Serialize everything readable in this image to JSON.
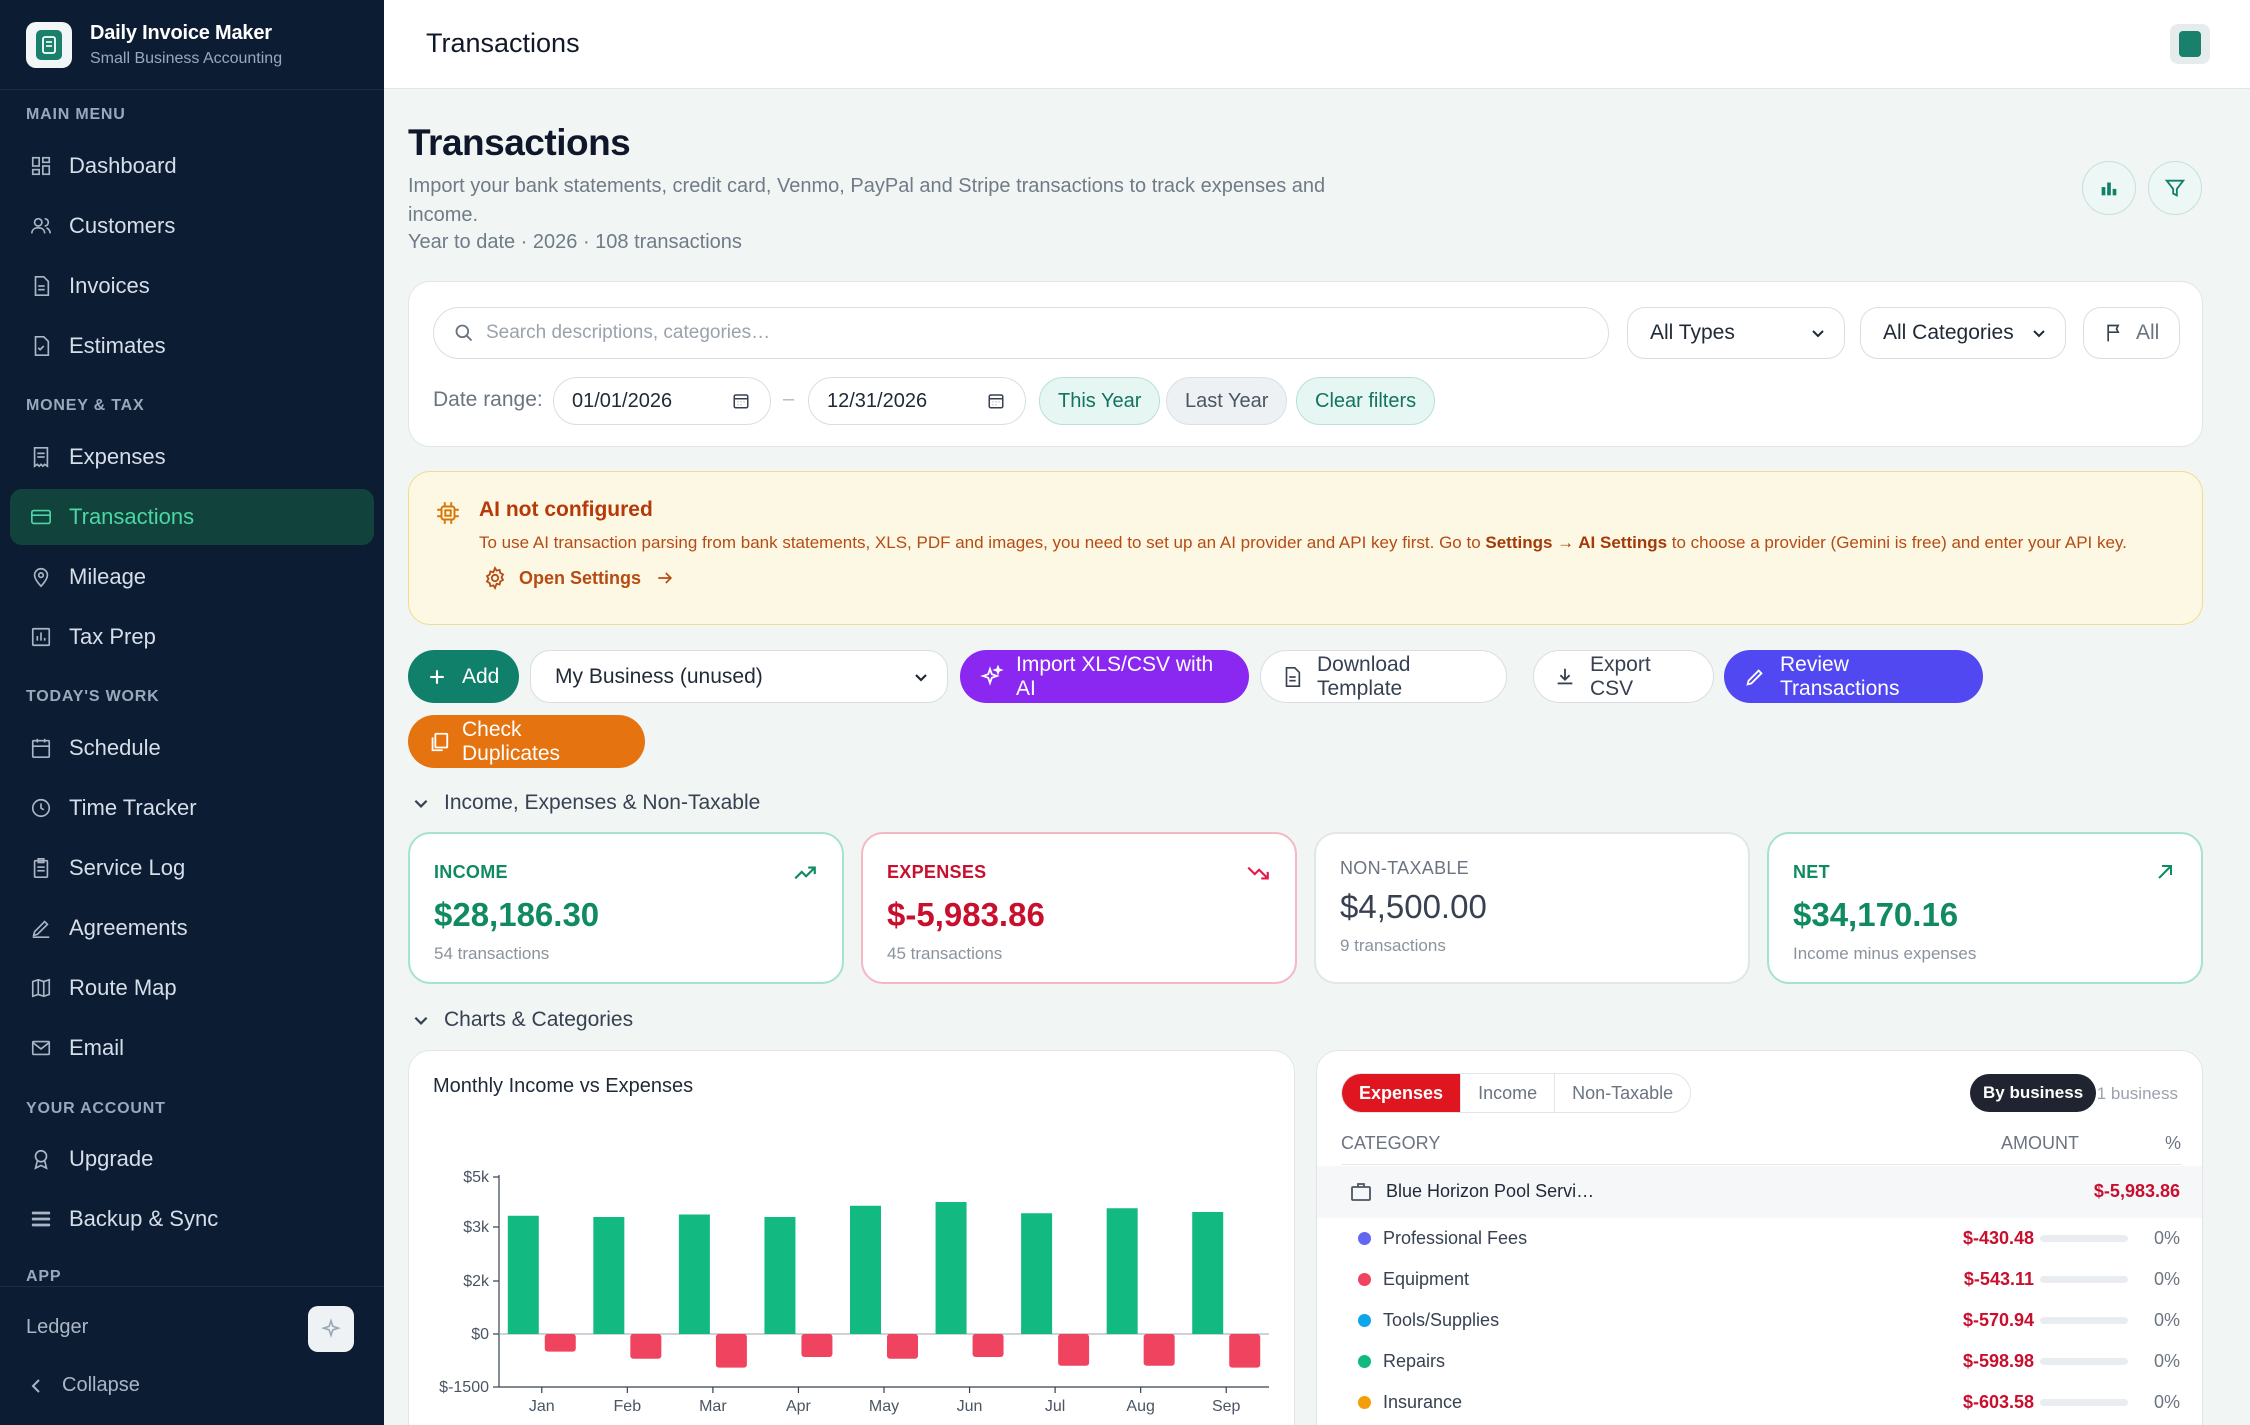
{
  "app": {
    "name": "Daily Invoice Maker",
    "tagline": "Small Business Accounting"
  },
  "sidebar": {
    "sections": [
      {
        "label": "MAIN MENU",
        "items": [
          {
            "label": "Dashboard",
            "icon": "grid-icon"
          },
          {
            "label": "Customers",
            "icon": "users-icon"
          },
          {
            "label": "Invoices",
            "icon": "document-icon"
          },
          {
            "label": "Estimates",
            "icon": "document-check-icon"
          }
        ]
      },
      {
        "label": "MONEY & TAX",
        "items": [
          {
            "label": "Expenses",
            "icon": "receipt-icon"
          },
          {
            "label": "Transactions",
            "icon": "card-icon",
            "active": true
          },
          {
            "label": "Mileage",
            "icon": "pin-icon"
          },
          {
            "label": "Tax Prep",
            "icon": "chart-box-icon"
          }
        ]
      },
      {
        "label": "TODAY'S WORK",
        "items": [
          {
            "label": "Schedule",
            "icon": "calendar-icon"
          },
          {
            "label": "Time Tracker",
            "icon": "clock-icon"
          },
          {
            "label": "Service Log",
            "icon": "clipboard-icon"
          },
          {
            "label": "Agreements",
            "icon": "pen-icon"
          },
          {
            "label": "Route Map",
            "icon": "map-icon"
          },
          {
            "label": "Email",
            "icon": "mail-icon"
          }
        ]
      },
      {
        "label": "YOUR ACCOUNT",
        "items": [
          {
            "label": "Upgrade",
            "icon": "award-icon"
          },
          {
            "label": "Backup & Sync",
            "icon": "layers-icon"
          }
        ]
      },
      {
        "label": "APP",
        "items": []
      }
    ],
    "footer": {
      "ledger_label": "Ledger",
      "collapse_label": "Collapse"
    }
  },
  "header": {
    "title": "Transactions"
  },
  "page": {
    "title": "Transactions",
    "description": "Import your bank statements, credit card, Venmo, PayPal and Stripe transactions to track expenses and income.",
    "meta": "Year to date · 2026 · 108 transactions"
  },
  "filters": {
    "search_placeholder": "Search descriptions, categories…",
    "type_value": "All Types",
    "category_value": "All Categories",
    "flag_value": "All",
    "date_range_label": "Date range:",
    "date_from": "01/01/2026",
    "date_separator": "–",
    "date_to": "12/31/2026",
    "chips": [
      "This Year",
      "Last Year",
      "Clear filters"
    ]
  },
  "alert": {
    "title": "AI not configured",
    "body_prefix": "To use AI transaction parsing from bank statements, XLS, PDF and images, you need to set up an AI provider and API key first. Go to ",
    "body_settings": "Settings",
    "body_arrow": " → ",
    "body_ai_settings": "AI Settings",
    "body_suffix": " to choose a provider (Gemini is free) and enter your API key.",
    "link_label": "Open Settings"
  },
  "actions": {
    "add_label": "Add",
    "business_select": "My Business (unused)",
    "import_label": "Import XLS/CSV with AI",
    "download_label": "Download Template",
    "export_label": "Export CSV",
    "review_label": "Review Transactions",
    "duplicates_label": "Check Duplicates"
  },
  "sections": {
    "summary_label": "Income, Expenses & Non-Taxable",
    "charts_label": "Charts & Categories"
  },
  "stats": [
    {
      "label": "INCOME",
      "value": "$28,186.30",
      "sub": "54 transactions",
      "color": "#0f8a62",
      "border": "#a5e3cd"
    },
    {
      "label": "EXPENSES",
      "value": "$-5,983.86",
      "sub": "45 transactions",
      "color": "#c8102e",
      "border": "#f3b8c3"
    },
    {
      "label": "NON-TAXABLE",
      "value": "$4,500.00",
      "sub": "9 transactions",
      "color": "#374151",
      "border": "#e1e6ea"
    },
    {
      "label": "NET",
      "value": "$34,170.16",
      "sub": "Income minus expenses",
      "color": "#0f8a62",
      "border": "#a5e3cd"
    }
  ],
  "chart_data": {
    "type": "bar",
    "title": "Monthly Income vs Expenses",
    "categories": [
      "Jan",
      "Feb",
      "Mar",
      "Apr",
      "May",
      "Jun",
      "Jul",
      "Aug",
      "Sep"
    ],
    "series": [
      {
        "values": [
          3450,
          3400,
          3500,
          3400,
          3850,
          4000,
          3550,
          3750,
          3600
        ],
        "color": "#12b981"
      },
      {
        "values": [
          -500,
          -700,
          -950,
          -650,
          -700,
          -650,
          -900,
          -900,
          -950
        ],
        "color": "#f0435f"
      }
    ],
    "yticks": [
      -1500,
      0,
      2000,
      3000,
      5000
    ],
    "ytick_labels": [
      "$-1500",
      "$0",
      "$2k",
      "$3k",
      "$5k"
    ],
    "xlabel": "",
    "ylabel": ""
  },
  "categories_panel": {
    "tabs": [
      "Expenses",
      "Income",
      "Non-Taxable"
    ],
    "by_business_label": "By business",
    "business_count": "1 business",
    "col_category": "CATEGORY",
    "col_amount": "AMOUNT",
    "col_pct": "%",
    "business": {
      "name": "Blue Horizon Pool Servi…",
      "amount": "$-5,983.86"
    },
    "rows": [
      {
        "name": "Professional Fees",
        "amount": "$-430.48",
        "pct": "0%",
        "color": "#6366f1"
      },
      {
        "name": "Equipment",
        "amount": "$-543.11",
        "pct": "0%",
        "color": "#f0435f"
      },
      {
        "name": "Tools/Supplies",
        "amount": "$-570.94",
        "pct": "0%",
        "color": "#0ea5e9"
      },
      {
        "name": "Repairs",
        "amount": "$-598.98",
        "pct": "0%",
        "color": "#10b981"
      },
      {
        "name": "Insurance",
        "amount": "$-603.58",
        "pct": "0%",
        "color": "#f59e0b"
      }
    ]
  }
}
